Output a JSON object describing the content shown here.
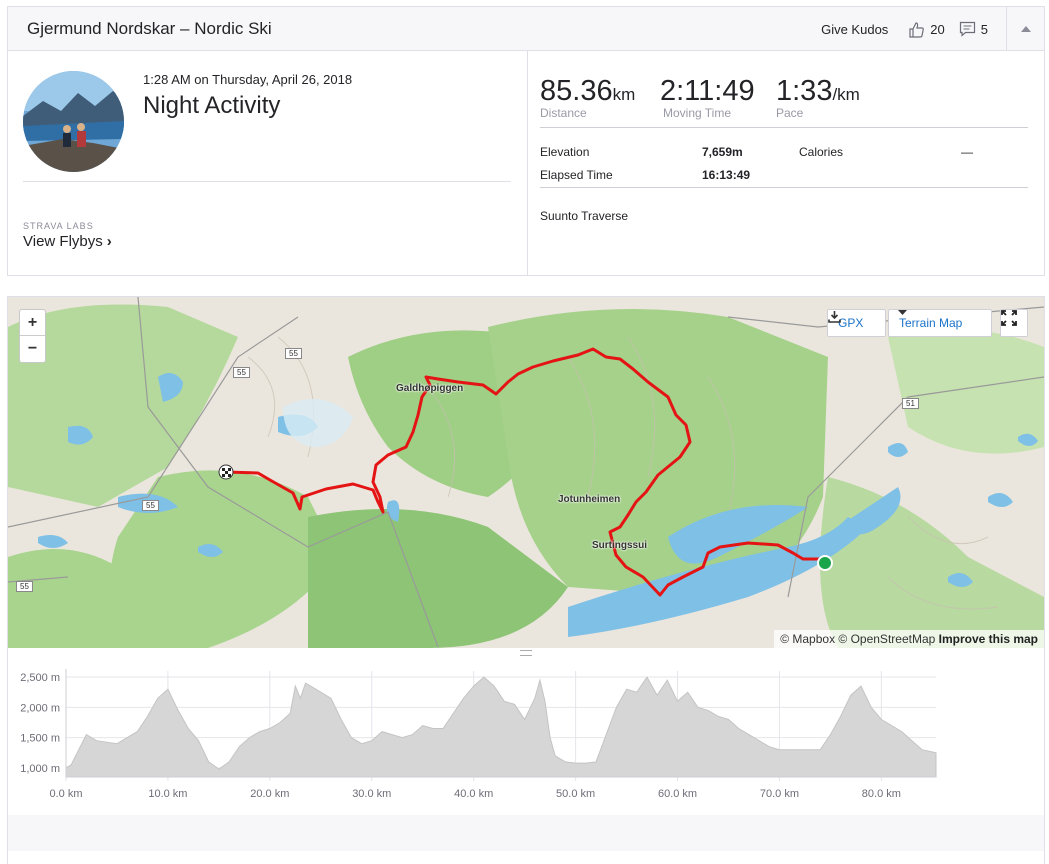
{
  "header": {
    "title": "Gjermund Nordskar – Nordic Ski",
    "give_kudos": "Give Kudos",
    "kudos_count": "20",
    "comments_count": "5"
  },
  "activity": {
    "date": "1:28 AM on Thursday, April 26, 2018",
    "name": "Night Activity",
    "labs_label": "STRAVA LABS",
    "flybys_label": "View Flybys",
    "device": "Suunto Traverse"
  },
  "stats": {
    "distance": {
      "value": "85.36",
      "unit": "km",
      "label": "Distance"
    },
    "moving_time": {
      "value": "2:11:49",
      "label": "Moving Time"
    },
    "pace": {
      "value": "1:33",
      "unit": "/km",
      "label": "Pace"
    },
    "elevation": {
      "label": "Elevation",
      "value": "7,659m"
    },
    "elapsed": {
      "label": "Elapsed Time",
      "value": "16:13:49"
    },
    "calories": {
      "label": "Calories",
      "value": "—"
    }
  },
  "map": {
    "zoom_in": "+",
    "zoom_out": "−",
    "gpx_label": "GPX",
    "terrain_label": "Terrain Map",
    "attribution_pre": "© Mapbox © OpenStreetMap",
    "attribution_link": "Improve this map",
    "labels": {
      "galdhopiggen": "Galdhøpiggen",
      "jotunheimen": "Jotunheimen",
      "surtingssui": "Surtingssui"
    },
    "roads": {
      "r55a": "55",
      "r55b": "55",
      "r55c": "55",
      "r55d": "55",
      "r51": "51"
    }
  },
  "chart_data": {
    "type": "area",
    "title": "",
    "xlabel": "",
    "ylabel": "",
    "x_ticks": [
      "0.0 km",
      "10.0 km",
      "20.0 km",
      "30.0 km",
      "40.0 km",
      "50.0 km",
      "60.0 km",
      "70.0 km",
      "80.0 km"
    ],
    "y_ticks": [
      "2,500 m",
      "2,000 m",
      "1,500 m",
      "1,000 m"
    ],
    "xlim": [
      0,
      85.36
    ],
    "ylim": [
      850,
      2600
    ],
    "x": [
      0,
      0.5,
      2,
      3,
      5,
      7,
      8,
      9,
      10,
      11,
      12,
      13,
      14,
      15,
      16,
      17,
      18,
      19,
      20,
      21,
      22,
      22.5,
      23,
      23.5,
      24,
      25,
      26,
      27,
      28,
      29,
      30,
      31,
      32,
      33,
      34,
      35,
      36,
      37,
      38,
      39,
      40,
      41,
      42,
      43,
      44,
      45,
      46,
      46.5,
      47,
      47.5,
      48,
      49,
      50,
      51,
      52,
      53,
      54,
      55,
      56,
      57,
      58,
      59,
      60,
      61,
      62,
      63,
      64,
      65,
      66,
      67,
      68,
      69,
      70,
      71,
      72,
      73,
      74,
      75,
      76,
      77,
      78,
      79,
      80,
      81,
      82,
      83,
      84,
      85.36
    ],
    "y": [
      1000,
      1050,
      1550,
      1450,
      1400,
      1600,
      1850,
      2150,
      2300,
      1950,
      1650,
      1450,
      1100,
      980,
      1100,
      1350,
      1500,
      1600,
      1650,
      1750,
      1900,
      2350,
      2150,
      2400,
      2350,
      2250,
      2150,
      1800,
      1500,
      1400,
      1450,
      1600,
      1550,
      1500,
      1550,
      1700,
      1650,
      1650,
      1900,
      2150,
      2350,
      2500,
      2350,
      2100,
      2050,
      1800,
      2150,
      2450,
      2100,
      1500,
      1200,
      1100,
      1080,
      1080,
      1100,
      1550,
      2000,
      2300,
      2250,
      2500,
      2200,
      2450,
      2100,
      2250,
      2000,
      1950,
      1850,
      1800,
      1650,
      1550,
      1450,
      1350,
      1300,
      1300,
      1300,
      1300,
      1300,
      1550,
      1850,
      2200,
      2350,
      2000,
      1800,
      1700,
      1600,
      1450,
      1300,
      1250
    ],
    "grid": true,
    "legend": "none"
  }
}
